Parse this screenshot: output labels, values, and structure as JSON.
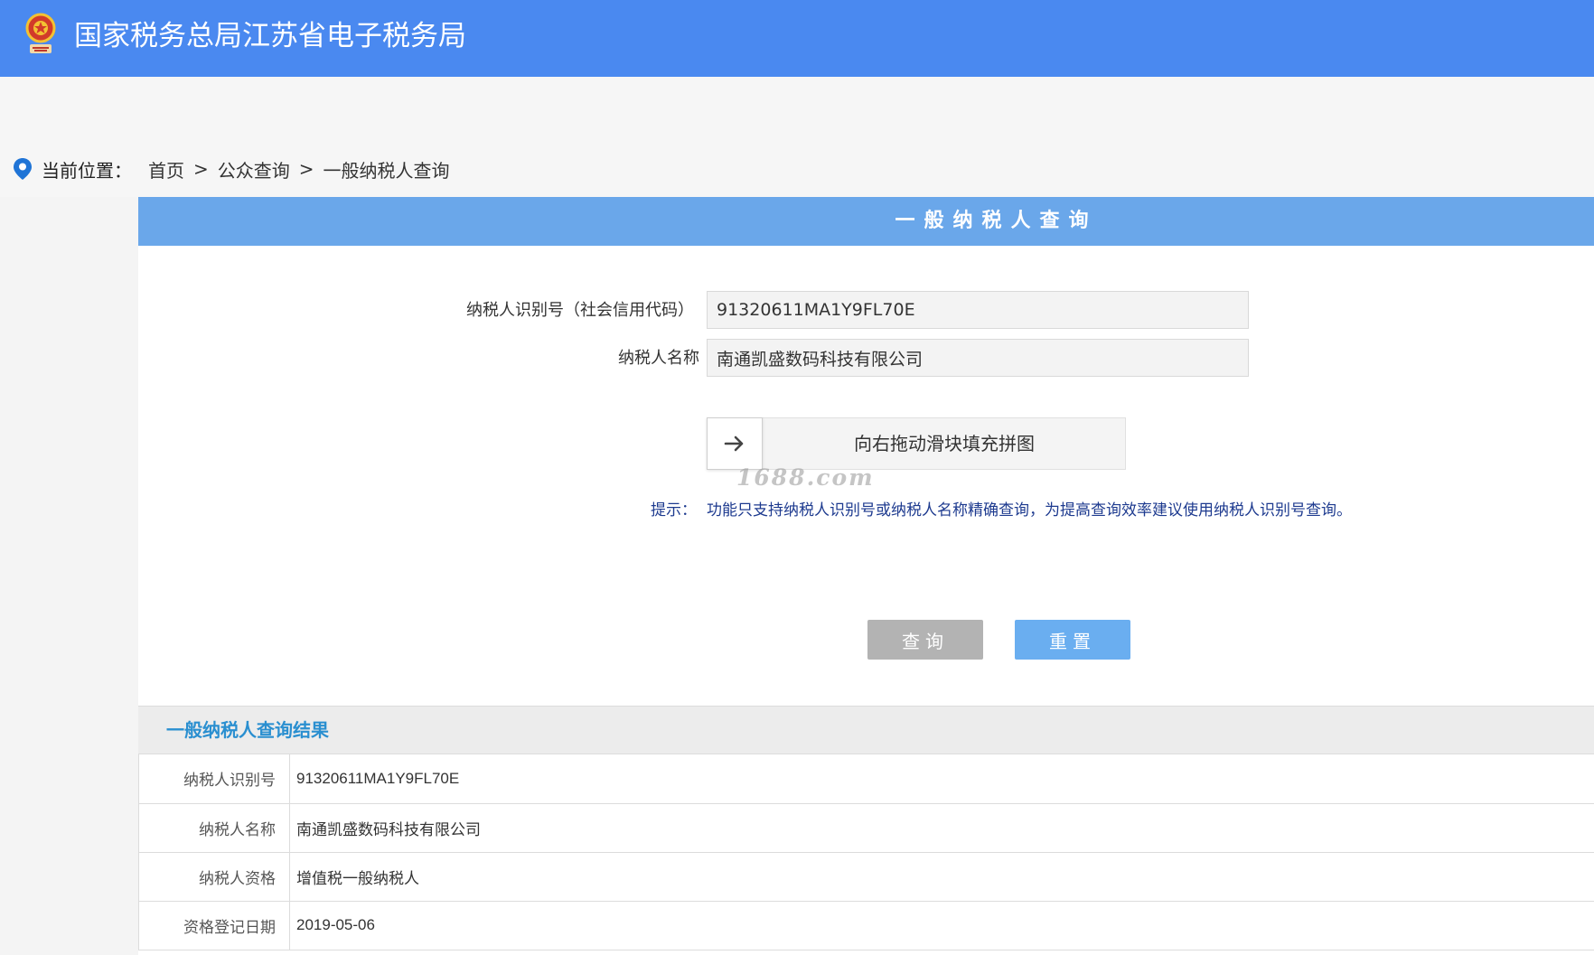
{
  "header": {
    "title": "国家税务总局江苏省电子税务局",
    "emblem_icon": "tax-emblem-icon"
  },
  "breadcrumb": {
    "label": "当前位置：",
    "items": [
      "首页",
      "公众查询",
      "一般纳税人查询"
    ],
    "separator": ">"
  },
  "query_form": {
    "title": "一般纳税人查询",
    "taxpayer_id_label": "纳税人识别号（社会信用代码）",
    "taxpayer_id_value": "91320611MA1Y9FL70E",
    "taxpayer_name_label": "纳税人名称",
    "taxpayer_name_value": "南通凯盛数码科技有限公司",
    "slider_text": "向右拖动滑块填充拼图",
    "slider_icon": "arrow-right-icon",
    "watermark": "1688.com",
    "tip_label": "提示：",
    "tip_text": "功能只支持纳税人识别号或纳税人名称精确查询，为提高查询效率建议使用纳税人识别号查询。",
    "query_button": "查询",
    "reset_button": "重置"
  },
  "results": {
    "title": "一般纳税人查询结果",
    "rows": [
      {
        "key": "纳税人识别号",
        "value": "91320611MA1Y9FL70E"
      },
      {
        "key": "纳税人名称",
        "value": "南通凯盛数码科技有限公司"
      },
      {
        "key": "纳税人资格",
        "value": "增值税一般纳税人"
      },
      {
        "key": "资格登记日期",
        "value": "2019-05-06"
      }
    ]
  },
  "colors": {
    "header_bg": "#4a89f0",
    "card_header_bg": "#6aa7ea",
    "query_button_bg": "#b3b3b3",
    "reset_button_bg": "#6aaef0",
    "results_title": "#2a8fd0",
    "tip_text": "#1d3a8f",
    "pin_icon": "#1f74d6"
  }
}
